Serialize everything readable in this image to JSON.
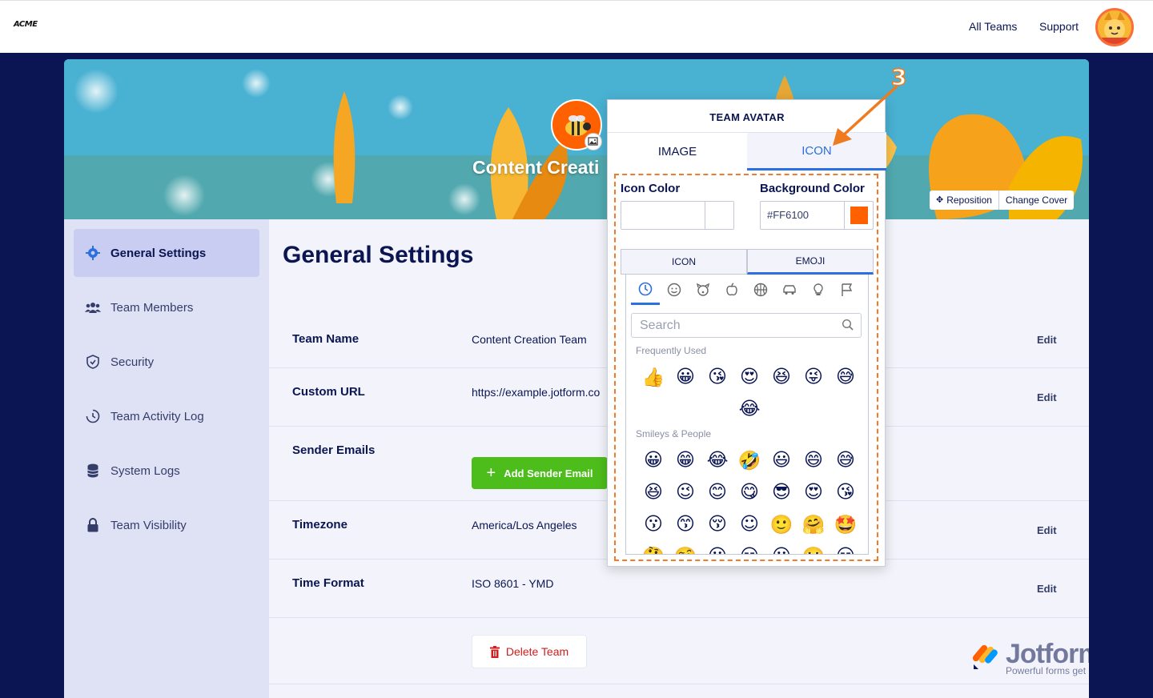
{
  "topbar": {
    "logo": "ACME",
    "all_teams": "All Teams",
    "support": "Support",
    "avatar_icon": "cat-face-icon"
  },
  "cover": {
    "team_name_overlay": "Content Creati",
    "reposition": "Reposition",
    "change_cover": "Change Cover"
  },
  "sidebar": {
    "items": [
      {
        "label": "General Settings",
        "icon": "gear-icon",
        "active": true
      },
      {
        "label": "Team Members",
        "icon": "users-icon"
      },
      {
        "label": "Security",
        "icon": "shield-icon"
      },
      {
        "label": "Team Activity Log",
        "icon": "history-icon"
      },
      {
        "label": "System Logs",
        "icon": "database-icon"
      },
      {
        "label": "Team Visibility",
        "icon": "lock-icon"
      }
    ]
  },
  "main": {
    "title": "General Settings",
    "rows": [
      {
        "label": "Team Name",
        "value": "Content Creation Team",
        "edit": "Edit"
      },
      {
        "label": "Custom URL",
        "value": "https://example.jotform.co",
        "edit": "Edit"
      },
      {
        "label": "Sender Emails",
        "button": "Add Sender Email"
      },
      {
        "label": "Timezone",
        "value": "America/Los Angeles",
        "edit": "Edit"
      },
      {
        "label": "Time Format",
        "value": "ISO 8601 - YMD",
        "edit": "Edit"
      }
    ],
    "delete_button": "Delete Team"
  },
  "popup": {
    "title": "TEAM AVATAR",
    "tabs": [
      "IMAGE",
      "ICON"
    ],
    "active_tab": "ICON",
    "icon_color_label": "Icon Color",
    "icon_color_value": "",
    "bg_color_label": "Background Color",
    "bg_color_value": "#FF6100",
    "sub_tabs": [
      "ICON",
      "EMOJI"
    ],
    "active_sub_tab": "EMOJI",
    "search_placeholder": "Search",
    "frequently_used_label": "Frequently Used",
    "frequently_used": [
      "👍",
      "😀",
      "😘",
      "😍",
      "😆",
      "😜",
      "😅",
      "😂"
    ],
    "smileys_label": "Smileys & People",
    "smileys": [
      [
        "😀",
        "😁",
        "😂",
        "🤣",
        "😃",
        "😄",
        "😅"
      ],
      [
        "😆",
        "😉",
        "😊",
        "😋",
        "😎",
        "😍",
        "😘"
      ],
      [
        "😗",
        "😙",
        "😚",
        "☺",
        "🙂",
        "🤗",
        "🤩"
      ],
      [
        "🤔",
        "🤨",
        "😐",
        "😑",
        "😶",
        "🙄",
        "😏"
      ]
    ]
  },
  "annotation": {
    "step": "3"
  },
  "watermark": {
    "brand": "Jotform",
    "tagline": "Powerful forms get"
  },
  "colors": {
    "accent": "#2c6fe0",
    "green": "#4dbd1b",
    "avatar_bg": "#ff6100",
    "highlight": "#f27a2a"
  }
}
